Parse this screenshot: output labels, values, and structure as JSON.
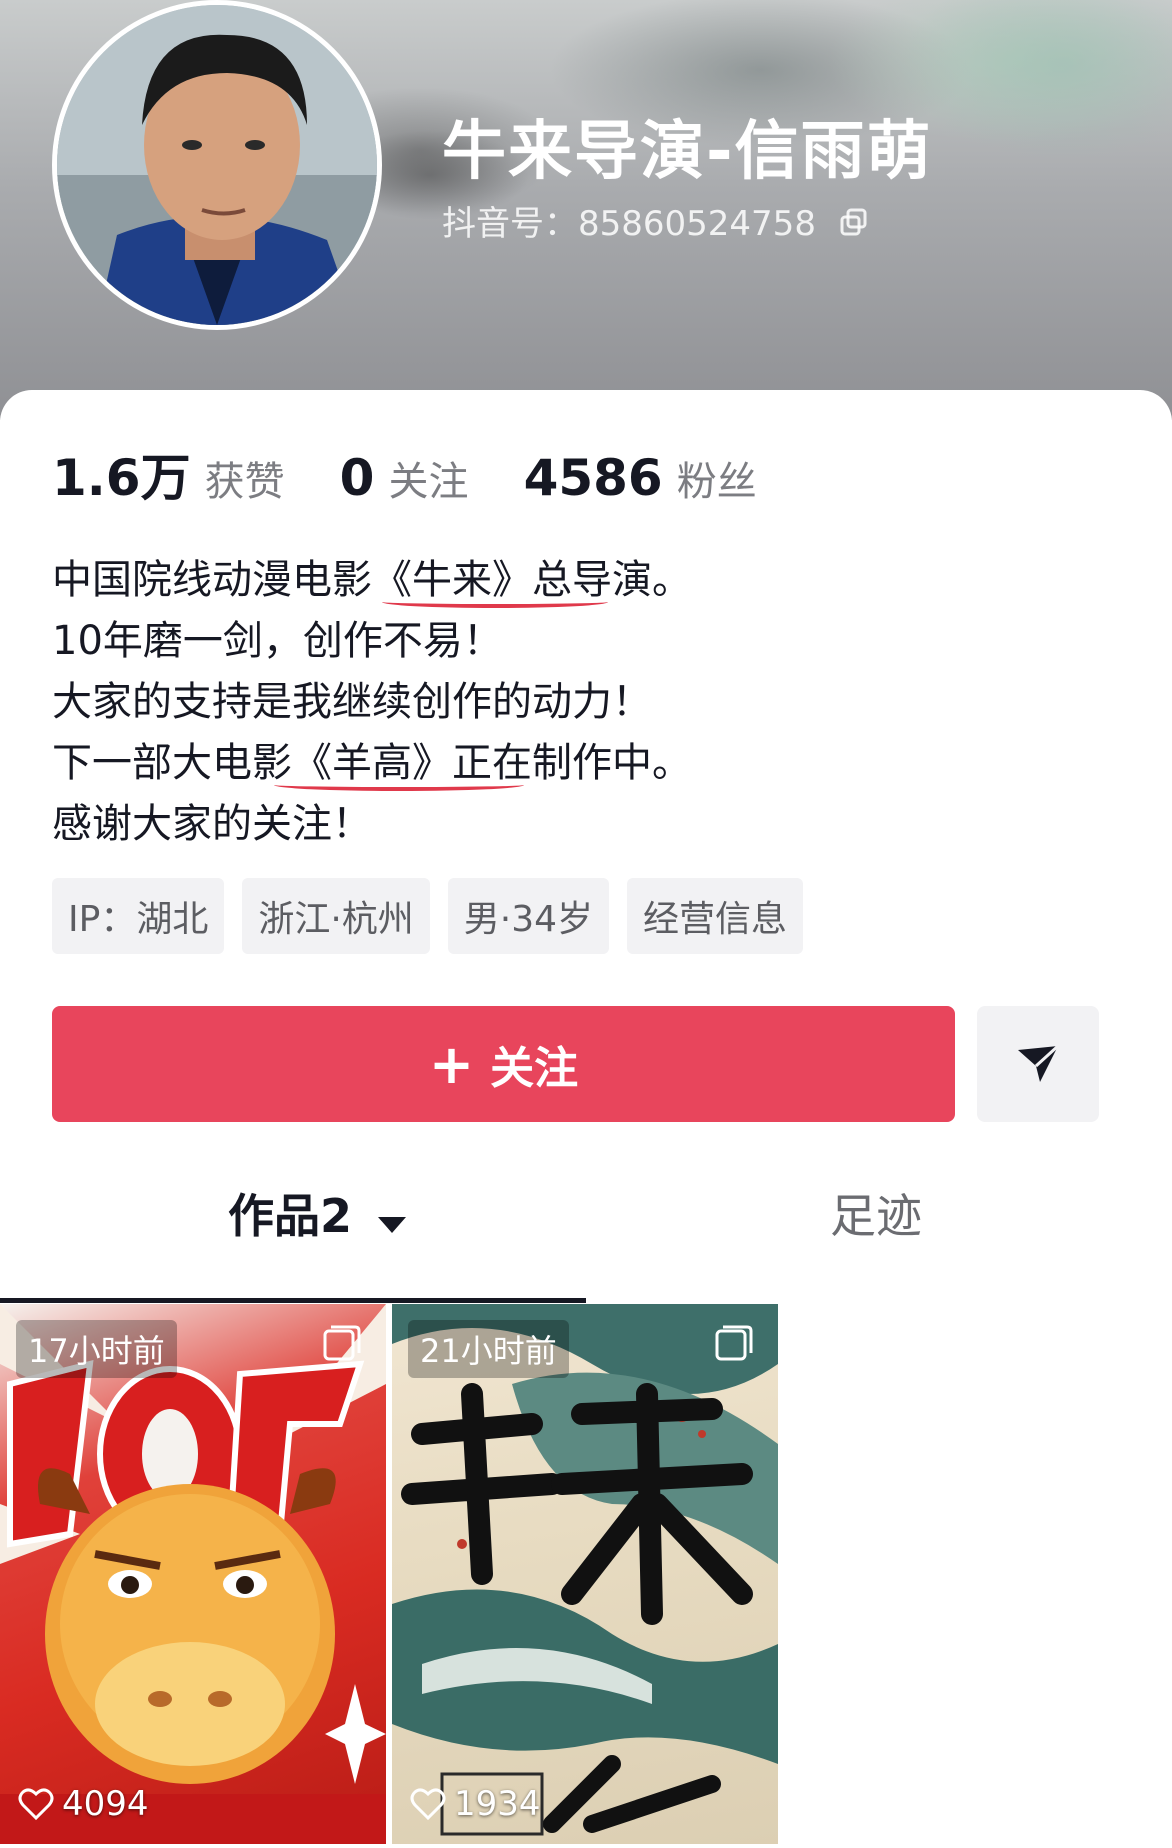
{
  "profile": {
    "name": "牛来导演-信雨萌",
    "douyin_id_label": "抖音号：",
    "douyin_id": "85860524758"
  },
  "stats": [
    {
      "value": "1.6万",
      "label": "获赞"
    },
    {
      "value": "0",
      "label": "关注"
    },
    {
      "value": "4586",
      "label": "粉丝"
    }
  ],
  "bio": [
    "中国院线动漫电影《牛来》总导演。",
    "10年磨一剑，创作不易！",
    "大家的支持是我继续创作的动力！",
    "下一部大电影《羊高》正在制作中。",
    "感谢大家的关注！"
  ],
  "tags": [
    "IP：湖北",
    "浙江·杭州",
    "男·34岁",
    "经营信息"
  ],
  "actions": {
    "follow_label": "关注",
    "plus": "+"
  },
  "tabs": {
    "works_label": "作品",
    "works_count": "2",
    "trace_label": "足迹"
  },
  "videos": [
    {
      "time": "17小时前",
      "likes": "4094"
    },
    {
      "time": "21小时前",
      "likes": "1934"
    }
  ],
  "colors": {
    "follow_button": "#e8455c",
    "underline": "#e0394b"
  }
}
